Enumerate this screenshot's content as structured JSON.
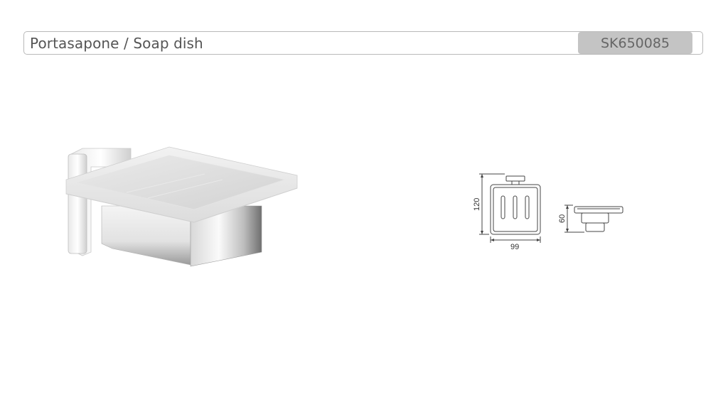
{
  "header": {
    "title": "Portasapone / Soap dish",
    "product_code": "SK650085"
  },
  "technical_drawing": {
    "height_front": "120",
    "width_front": "99",
    "depth_side": "60"
  },
  "colors": {
    "badge_bg": "#c4c4c4",
    "border": "#b9b9b9",
    "text": "#555555"
  }
}
